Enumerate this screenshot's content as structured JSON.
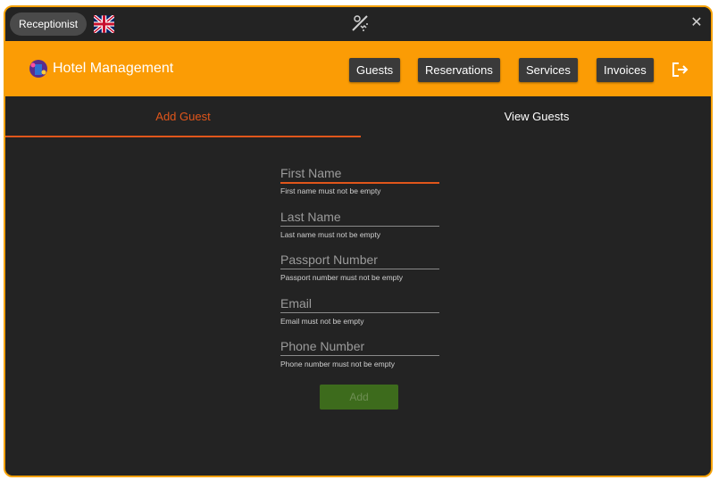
{
  "titlebar": {
    "role": "Receptionist",
    "close_glyph": "✕"
  },
  "icons": {
    "flag": "uk-flag-icon",
    "theme": "theme-toggle-icon",
    "logo": "hotel-logo-icon",
    "logout": "logout-icon"
  },
  "colors": {
    "accent": "#fb9c05",
    "active_tab": "#e0561b",
    "background": "#232323",
    "button": "#3a3a3a",
    "add_button": "#3d6b1c"
  },
  "appbar": {
    "title": "Hotel Management",
    "nav": [
      "Guests",
      "Reservations",
      "Services",
      "Invoices"
    ]
  },
  "tabs": {
    "add": "Add Guest",
    "view": "View Guests"
  },
  "form": {
    "fields": [
      {
        "label": "First Name",
        "error": "First name must not be empty"
      },
      {
        "label": "Last Name",
        "error": "Last name must not be empty"
      },
      {
        "label": "Passport Number",
        "error": "Passport number must not be empty"
      },
      {
        "label": "Email",
        "error": "Email must not be empty"
      },
      {
        "label": "Phone Number",
        "error": "Phone number must not be empty"
      }
    ],
    "submit": "Add"
  }
}
